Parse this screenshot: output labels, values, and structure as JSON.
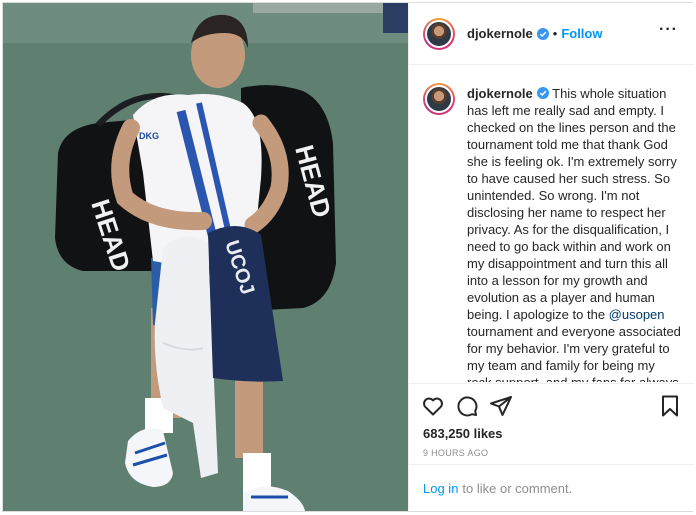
{
  "post": {
    "username": "djokernole",
    "follow_label": "Follow",
    "separator": "•",
    "more_label": "···",
    "caption_before": "This whole situation has left me really sad and empty. I checked on the lines person and the tournament told me that thank God she is feeling ok. I'm extremely sorry to have caused her such stress. So unintended. So wrong. I'm not disclosing her name to respect her privacy. As for the disqualification, I need to go back within and work on my disappointment and turn this all into a lesson for my growth and evolution as a player and human being. I apologize to the ",
    "mention": "@usopen",
    "caption_after": " tournament and everyone associated for my behavior. I'm very grateful to my team and family for being my rock support, and my fans for always being there with me. Thank you and I'm so",
    "likes": "683,250 likes",
    "timestamp": "9 HOURS AGO"
  },
  "photo": {
    "bag_text": "HEAD",
    "shirt_text": "UCOJ",
    "badge_text": "DKG"
  },
  "comment_bar": {
    "login_label": "Log in",
    "rest": "to like or comment."
  },
  "icons": {
    "like": "heart-icon",
    "comment": "comment-icon",
    "share": "share-icon",
    "save": "bookmark-icon",
    "verified": "verified-badge-icon"
  },
  "colors": {
    "link": "#0095f6",
    "verified": "#3897f0",
    "court": "#5f7f70"
  }
}
